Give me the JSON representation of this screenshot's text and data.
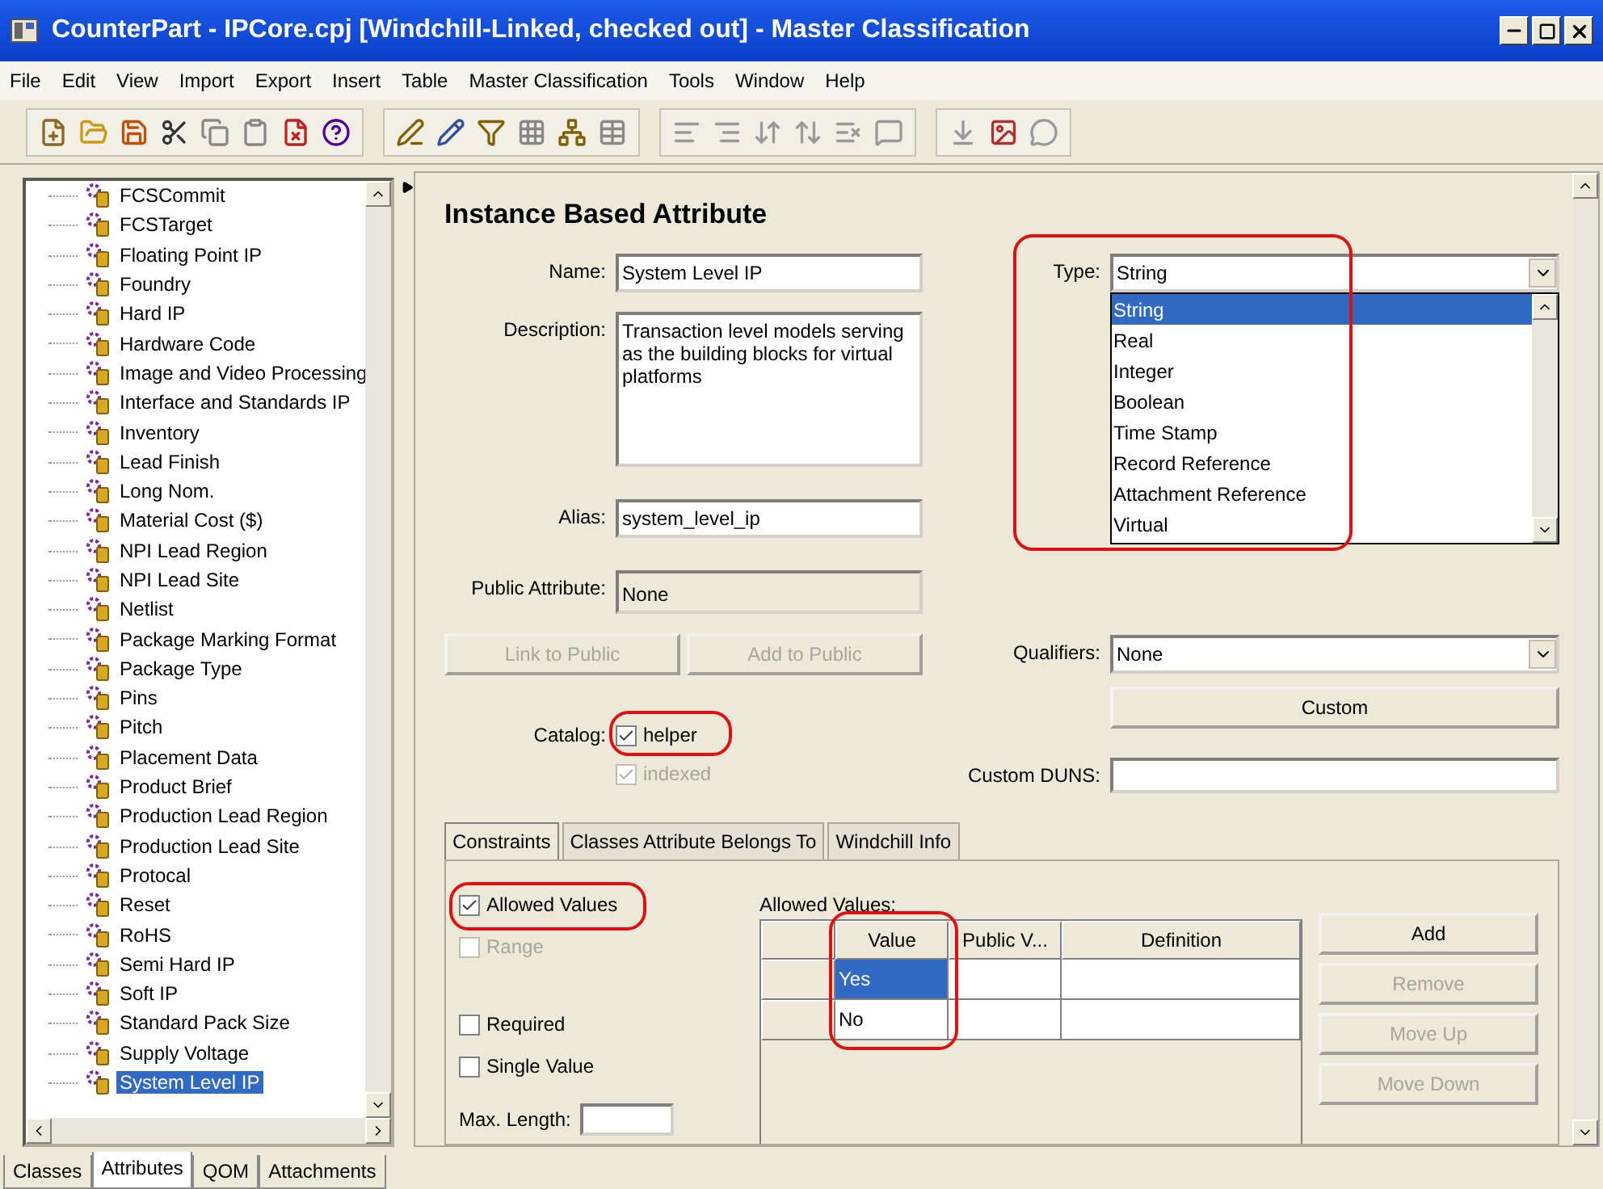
{
  "window": {
    "title": "CounterPart - IPCore.cpj [Windchill-Linked, checked out] - Master Classification"
  },
  "menu": [
    "File",
    "Edit",
    "View",
    "Import",
    "Export",
    "Insert",
    "Table",
    "Master Classification",
    "Tools",
    "Window",
    "Help"
  ],
  "tree": {
    "items": [
      {
        "label": "FCSCommit",
        "selected": false
      },
      {
        "label": "FCSTarget",
        "selected": false
      },
      {
        "label": "Floating Point IP",
        "selected": false
      },
      {
        "label": "Foundry",
        "selected": false
      },
      {
        "label": "Hard IP",
        "selected": false
      },
      {
        "label": "Hardware Code",
        "selected": false
      },
      {
        "label": "Image and Video Processing",
        "selected": false
      },
      {
        "label": "Interface and Standards IP",
        "selected": false
      },
      {
        "label": "Inventory",
        "selected": false
      },
      {
        "label": "Lead Finish",
        "selected": false
      },
      {
        "label": "Long Nom.",
        "selected": false
      },
      {
        "label": "Material Cost ($)",
        "selected": false
      },
      {
        "label": "NPI Lead Region",
        "selected": false
      },
      {
        "label": "NPI Lead Site",
        "selected": false
      },
      {
        "label": "Netlist",
        "selected": false
      },
      {
        "label": "Package Marking Format",
        "selected": false
      },
      {
        "label": "Package Type",
        "selected": false
      },
      {
        "label": "Pins",
        "selected": false
      },
      {
        "label": "Pitch",
        "selected": false
      },
      {
        "label": "Placement Data",
        "selected": false
      },
      {
        "label": "Product Brief",
        "selected": false
      },
      {
        "label": "Production Lead Region",
        "selected": false
      },
      {
        "label": "Production Lead Site",
        "selected": false
      },
      {
        "label": "Protocal",
        "selected": false
      },
      {
        "label": "Reset",
        "selected": false
      },
      {
        "label": "RoHS",
        "selected": false
      },
      {
        "label": "Semi Hard IP",
        "selected": false
      },
      {
        "label": "Soft IP",
        "selected": false
      },
      {
        "label": "Standard Pack Size",
        "selected": false
      },
      {
        "label": "Supply Voltage",
        "selected": false
      },
      {
        "label": "System Level IP",
        "selected": true
      }
    ]
  },
  "panel_tabs": [
    {
      "label": "Classes",
      "selected": false
    },
    {
      "label": "Attributes",
      "selected": true
    },
    {
      "label": "QOM",
      "selected": false
    },
    {
      "label": "Attachments",
      "selected": false
    }
  ],
  "form": {
    "heading": "Instance Based Attribute",
    "name": {
      "label": "Name:",
      "value": "System Level IP"
    },
    "description": {
      "label": "Description:",
      "value": "Transaction level models serving as the building blocks for virtual platforms"
    },
    "alias": {
      "label": "Alias:",
      "value": "system_level_ip"
    },
    "public_attribute": {
      "label": "Public Attribute:",
      "value": "None"
    },
    "buttons": [
      {
        "label": "Link to Public",
        "disabled": true
      },
      {
        "label": "Add to Public",
        "disabled": true
      }
    ],
    "catalog": {
      "label": "Catalog:",
      "options": [
        {
          "label": "helper",
          "checked": true,
          "disabled": false
        },
        {
          "label": "indexed",
          "checked": true,
          "disabled": true
        }
      ]
    },
    "type": {
      "label": "Type:",
      "value": "String",
      "options": [
        {
          "label": "String",
          "selected": true
        },
        {
          "label": "Real",
          "selected": false
        },
        {
          "label": "Integer",
          "selected": false
        },
        {
          "label": "Boolean",
          "selected": false
        },
        {
          "label": "Time Stamp",
          "selected": false
        },
        {
          "label": "Record Reference",
          "selected": false
        },
        {
          "label": "Attachment Reference",
          "selected": false
        },
        {
          "label": "Virtual",
          "selected": false
        }
      ]
    },
    "qualifiers": {
      "label": "Qualifiers:",
      "value": "None"
    },
    "custom_button": "Custom",
    "custom_duns": {
      "label": "Custom DUNS:"
    }
  },
  "tabs": [
    {
      "label": "Constraints",
      "selected": true
    },
    {
      "label": "Classes Attribute Belongs To",
      "selected": false
    },
    {
      "label": "Windchill Info",
      "selected": false
    }
  ],
  "constraints": {
    "checks": [
      {
        "label": "Allowed Values",
        "checked": true,
        "disabled": false
      },
      {
        "label": "Range",
        "checked": false,
        "disabled": true
      },
      {
        "label": "Required",
        "checked": false,
        "disabled": false
      },
      {
        "label": "Single Value",
        "checked": false,
        "disabled": false
      }
    ],
    "max_length": {
      "label": "Max. Length:"
    },
    "allowed_values": {
      "label": "Allowed Values:",
      "columns": [
        "Value",
        "Public V...",
        "Definition"
      ],
      "rows": [
        {
          "value": "Yes",
          "selected": true
        },
        {
          "value": "No",
          "selected": false
        }
      ]
    },
    "buttons": [
      {
        "label": "Add",
        "disabled": false
      },
      {
        "label": "Remove",
        "disabled": true
      },
      {
        "label": "Move Up",
        "disabled": true
      },
      {
        "label": "Move Down",
        "disabled": true
      }
    ]
  }
}
